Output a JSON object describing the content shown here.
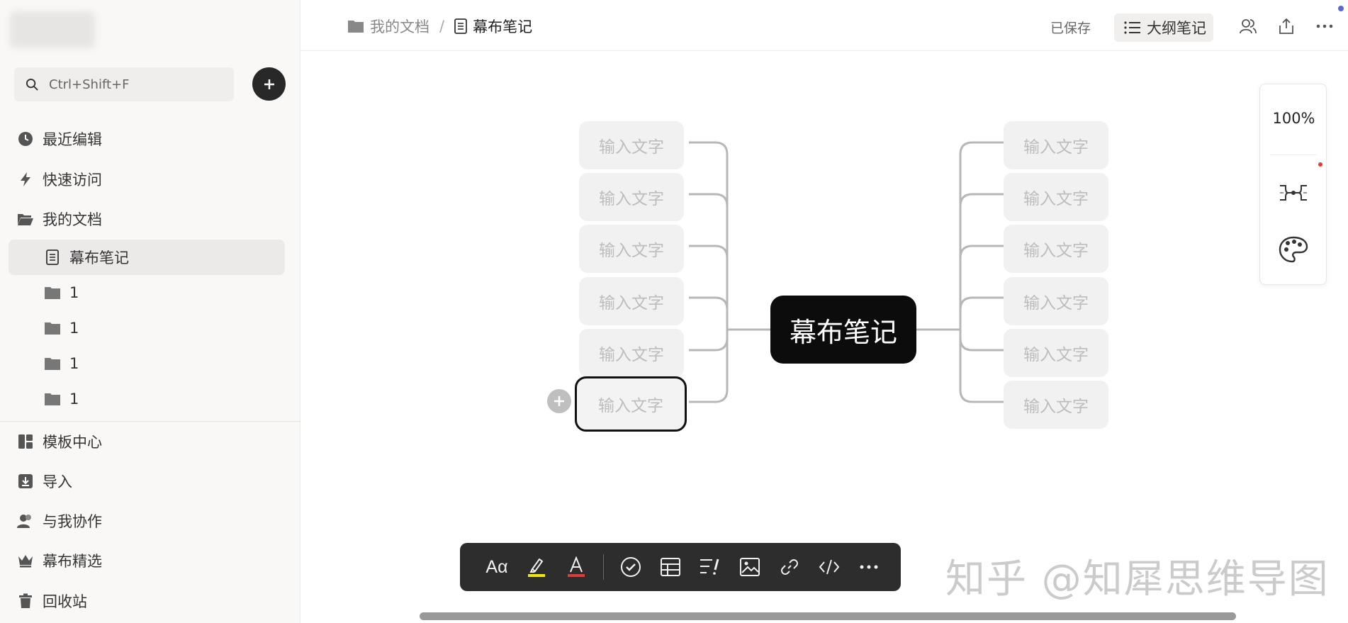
{
  "sidebar": {
    "search_placeholder": "Ctrl+Shift+F",
    "items": [
      {
        "label": "最近编辑",
        "icon": "clock-icon"
      },
      {
        "label": "快速访问",
        "icon": "lightning-icon"
      },
      {
        "label": "我的文档",
        "icon": "folder-open-icon"
      },
      {
        "label": "幕布笔记",
        "icon": "document-icon"
      },
      {
        "label": "1",
        "icon": "folder-icon"
      },
      {
        "label": "1",
        "icon": "folder-icon"
      },
      {
        "label": "1",
        "icon": "folder-icon"
      },
      {
        "label": "1",
        "icon": "folder-icon"
      },
      {
        "label": "模板中心",
        "icon": "template-icon"
      },
      {
        "label": "导入",
        "icon": "import-icon"
      },
      {
        "label": "与我协作",
        "icon": "users-icon"
      },
      {
        "label": "幕布精选",
        "icon": "crown-icon"
      },
      {
        "label": "回收站",
        "icon": "trash-icon"
      }
    ]
  },
  "header": {
    "breadcrumb_parent": "我的文档",
    "breadcrumb_separator": "/",
    "breadcrumb_current": "幕布笔记",
    "save_status": "已保存",
    "outline_button": "大纲笔记"
  },
  "mindmap": {
    "root": "幕布笔记",
    "left_nodes": [
      "输入文字",
      "输入文字",
      "输入文字",
      "输入文字",
      "输入文字",
      "输入文字"
    ],
    "right_nodes": [
      "输入文字",
      "输入文字",
      "输入文字",
      "输入文字",
      "输入文字",
      "输入文字"
    ]
  },
  "panel": {
    "zoom": "100%"
  },
  "toolbar": {
    "font_label": "Aα",
    "items": [
      "font-style-icon",
      "highlighter-icon",
      "text-color-icon",
      "checkbox-icon",
      "table-icon",
      "important-icon",
      "image-icon",
      "link-icon",
      "code-icon",
      "more-icon"
    ]
  },
  "watermark": "知乎 @知犀思维导图",
  "colors": {
    "root_bg": "#0c0c0c",
    "node_bg": "#f1f1f1",
    "highlight": "#f5e600",
    "text_color_red": "#e53935",
    "accent_dot": "#5a67d8"
  }
}
